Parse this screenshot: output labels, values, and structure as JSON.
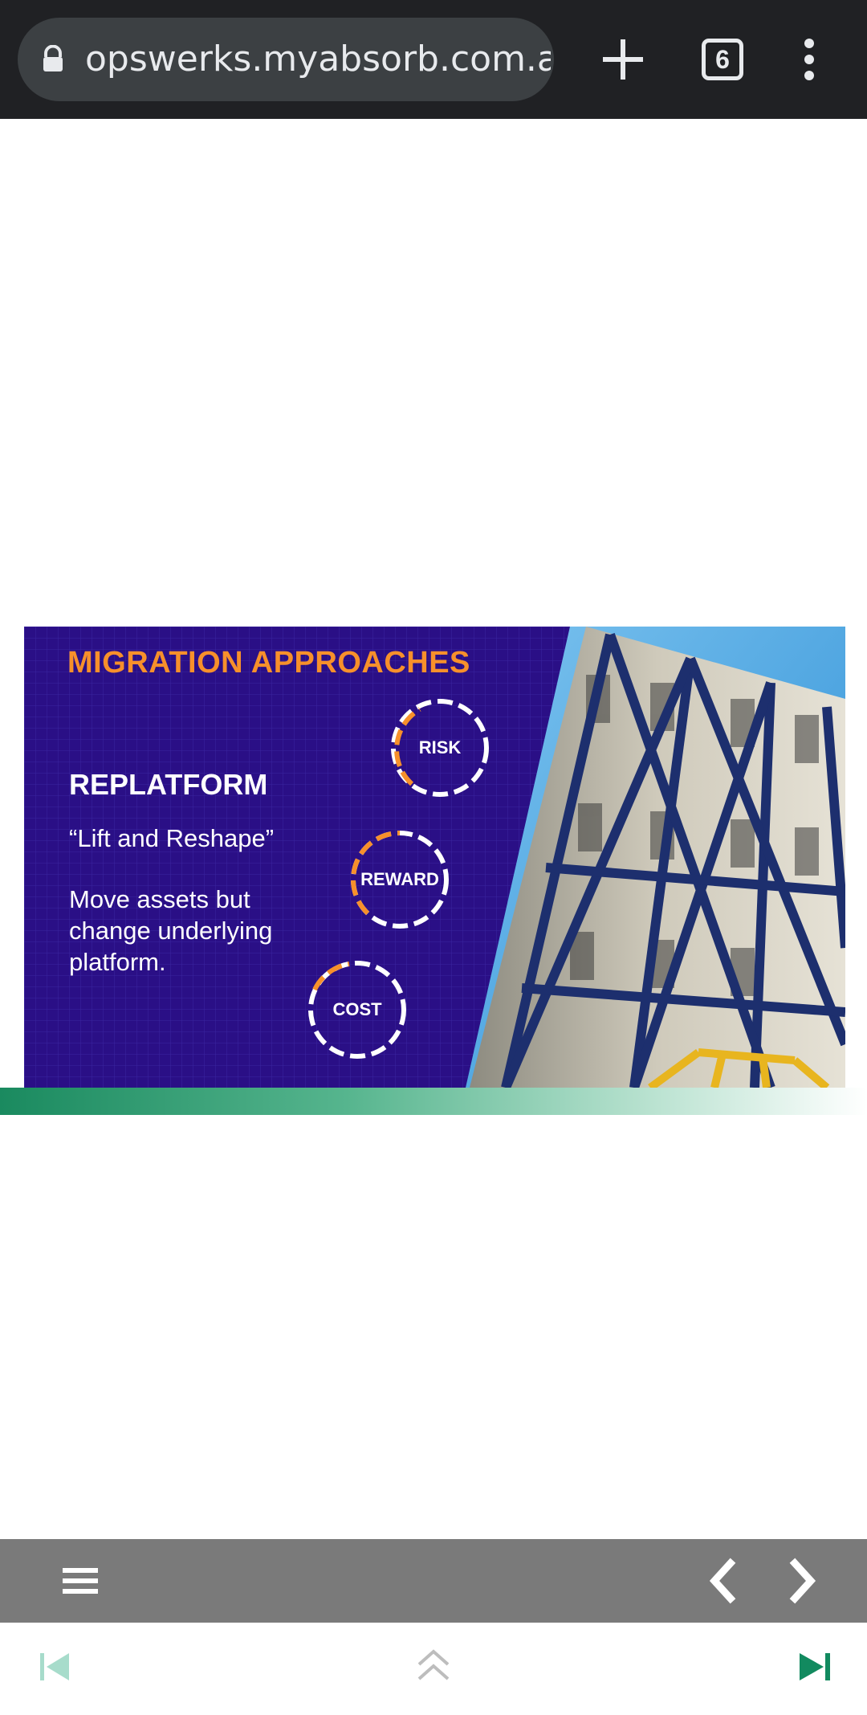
{
  "browser": {
    "url": "opswerks.myabsorb.com.au",
    "tab_count": "6"
  },
  "slide": {
    "title": "MIGRATION APPROACHES",
    "approach": "REPLATFORM",
    "tagline": "“Lift and Reshape”",
    "description": "Move assets but change underlying platform.",
    "gauges": [
      "RISK",
      "REWARD",
      "COST"
    ]
  },
  "colors": {
    "slide_bg": "#2a0f86",
    "accent_orange": "#f7902b",
    "progress_green": "#1a8a5f",
    "player_bar": "#7a7a7a"
  },
  "icons": {
    "lock": "lock-icon",
    "new_tab": "plus-icon",
    "tabs": "tab-switcher-icon",
    "overflow": "more-vert-icon",
    "menu": "hamburger-icon",
    "prev": "chevron-left-icon",
    "next": "chevron-right-icon",
    "first": "skip-previous-icon",
    "up": "double-chevron-up-icon",
    "last": "skip-next-icon"
  }
}
